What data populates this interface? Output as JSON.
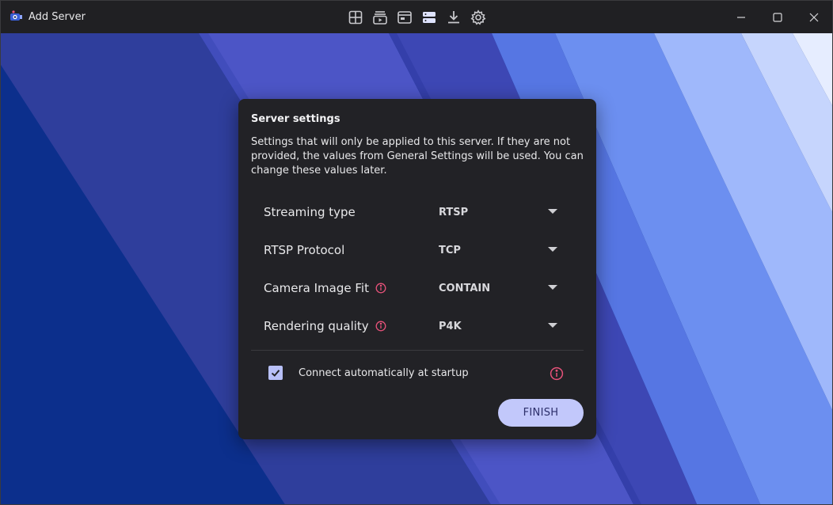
{
  "window": {
    "title": "Add Server",
    "icons": [
      "app-icon",
      "grid-icon",
      "playlist-icon",
      "window-icon",
      "server-icon",
      "download-icon",
      "gear-icon",
      "minimize-icon",
      "maximize-icon",
      "close-icon"
    ]
  },
  "dialog": {
    "title": "Server settings",
    "description": "Settings that will only be applied to this server. If they are not provided, the values from General Settings will be used. You can change these values later.",
    "settings": [
      {
        "label": "Streaming type",
        "value": "RTSP",
        "info": false
      },
      {
        "label": "RTSP Protocol",
        "value": "TCP",
        "info": false
      },
      {
        "label": "Camera Image Fit",
        "value": "CONTAIN",
        "info": true
      },
      {
        "label": "Rendering quality",
        "value": "P4K",
        "info": true
      }
    ],
    "auto_connect": {
      "label": "Connect automatically at startup",
      "checked": true
    },
    "finish_label": "FINISH"
  },
  "colors": {
    "accent": "#c2c8fb",
    "info": "#e8527a",
    "dialog_bg": "#222226"
  }
}
